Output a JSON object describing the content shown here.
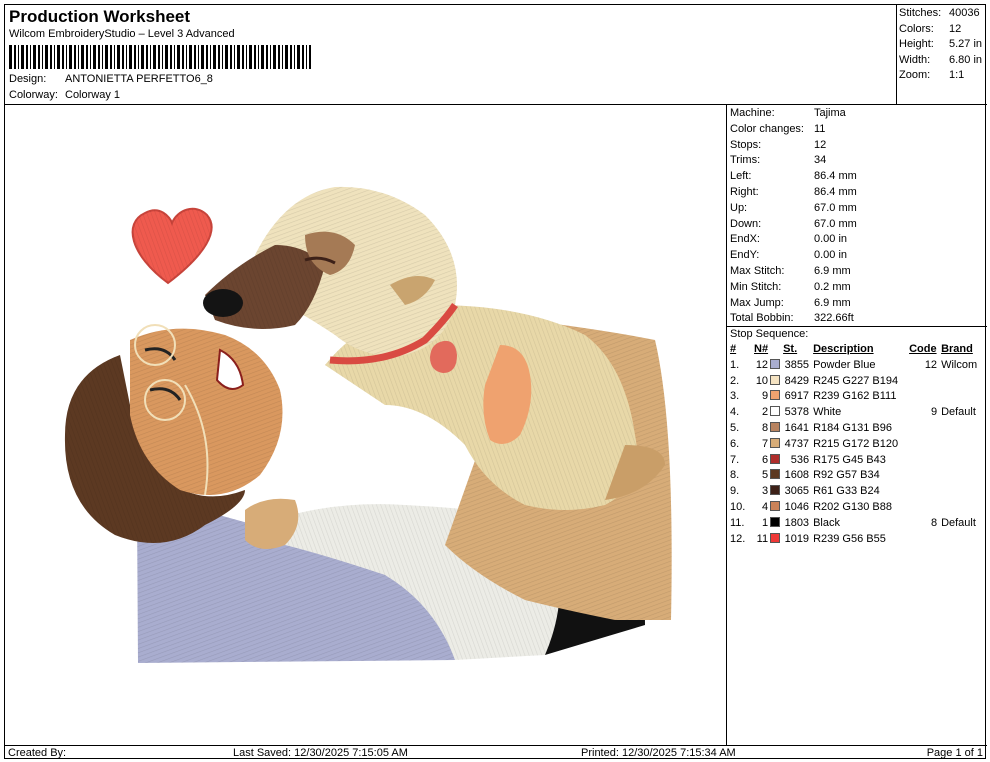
{
  "header": {
    "title": "Production Worksheet",
    "subtitle": "Wilcom EmbroideryStudio – Level 3 Advanced",
    "design_label": "Design:",
    "design_value": "ANTONIETTA PERFETTO6_8",
    "colorway_label": "Colorway:",
    "colorway_value": "Colorway 1"
  },
  "stats": [
    {
      "label": "Stitches:",
      "value": "40036"
    },
    {
      "label": "Colors:",
      "value": "12"
    },
    {
      "label": "Height:",
      "value": "5.27 in"
    },
    {
      "label": "Width:",
      "value": "6.80 in"
    },
    {
      "label": "Zoom:",
      "value": "1:1"
    }
  ],
  "specs": [
    {
      "label": "Machine:",
      "value": "Tajima"
    },
    {
      "label": "Color changes:",
      "value": "11"
    },
    {
      "label": "Stops:",
      "value": "12"
    },
    {
      "label": "Trims:",
      "value": "34"
    },
    {
      "label": "Left:",
      "value": "86.4 mm"
    },
    {
      "label": "Right:",
      "value": "86.4 mm"
    },
    {
      "label": "Up:",
      "value": "67.0 mm"
    },
    {
      "label": "Down:",
      "value": "67.0 mm"
    },
    {
      "label": "EndX:",
      "value": "0.00 in"
    },
    {
      "label": "EndY:",
      "value": "0.00 in"
    },
    {
      "label": "Max Stitch:",
      "value": "6.9 mm"
    },
    {
      "label": "Min Stitch:",
      "value": "0.2 mm"
    },
    {
      "label": "Max Jump:",
      "value": "6.9 mm"
    },
    {
      "label": "Total Bobbin:",
      "value": "322.66ft"
    }
  ],
  "stop_sequence": {
    "title": "Stop Sequence:",
    "headers": {
      "idx": "#",
      "n": "N#",
      "st": "St.",
      "desc": "Description",
      "code": "Code",
      "brand": "Brand"
    },
    "rows": [
      {
        "idx": "1.",
        "n": "12",
        "color": "#a9adcf",
        "st": "3855",
        "desc": "Powder Blue",
        "code": "12",
        "brand": "Wilcom"
      },
      {
        "idx": "2.",
        "n": "10",
        "color": "#f5e3c2",
        "st": "8429",
        "desc": "R245 G227 B194",
        "code": "",
        "brand": ""
      },
      {
        "idx": "3.",
        "n": "9",
        "color": "#efa26f",
        "st": "6917",
        "desc": "R239 G162 B111",
        "code": "",
        "brand": ""
      },
      {
        "idx": "4.",
        "n": "2",
        "color": "#ffffff",
        "st": "5378",
        "desc": "White",
        "code": "9",
        "brand": "Default"
      },
      {
        "idx": "5.",
        "n": "8",
        "color": "#b88360",
        "st": "1641",
        "desc": "R184 G131 B96",
        "code": "",
        "brand": ""
      },
      {
        "idx": "6.",
        "n": "7",
        "color": "#d7ac78",
        "st": "4737",
        "desc": "R215 G172 B120",
        "code": "",
        "brand": ""
      },
      {
        "idx": "7.",
        "n": "6",
        "color": "#af2d2b",
        "st": "536",
        "desc": "R175 G45 B43",
        "code": "",
        "brand": ""
      },
      {
        "idx": "8.",
        "n": "5",
        "color": "#5c3922",
        "st": "1608",
        "desc": "R92 G57 B34",
        "code": "",
        "brand": ""
      },
      {
        "idx": "9.",
        "n": "3",
        "color": "#3d2118",
        "st": "3065",
        "desc": "R61 G33 B24",
        "code": "",
        "brand": ""
      },
      {
        "idx": "10.",
        "n": "4",
        "color": "#ca8258",
        "st": "1046",
        "desc": "R202 G130 B88",
        "code": "",
        "brand": ""
      },
      {
        "idx": "11.",
        "n": "1",
        "color": "#000000",
        "st": "1803",
        "desc": "Black",
        "code": "8",
        "brand": "Default"
      },
      {
        "idx": "12.",
        "n": "11",
        "color": "#ef3837",
        "st": "1019",
        "desc": "R239 G56 B55",
        "code": "",
        "brand": ""
      }
    ]
  },
  "footer": {
    "created_by": "Created By:",
    "last_saved": "Last Saved: 12/30/2025 7:15:05 AM",
    "printed": "Printed: 12/30/2025 7:15:34 AM",
    "page": "Page 1 of 1"
  }
}
